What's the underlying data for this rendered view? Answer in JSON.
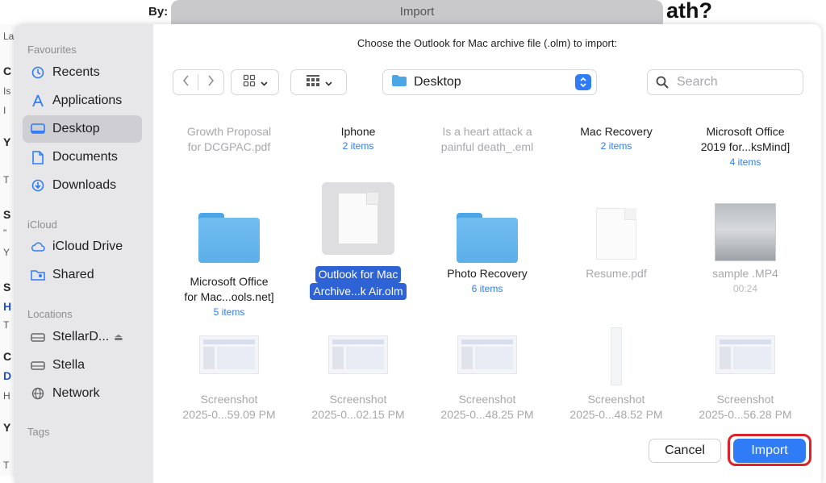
{
  "background": {
    "by_label": "By:",
    "title_fragment": "ath?",
    "left_letters": [
      "La",
      "C",
      "Is",
      "I",
      "Y",
      "T",
      "S",
      "\"",
      "Y",
      "S",
      "H",
      "T",
      "C",
      "D",
      "H",
      "Y",
      "T"
    ]
  },
  "titlebar": {
    "title": "Import"
  },
  "sidebar": {
    "favourites_label": "Favourites",
    "favourites": [
      {
        "label": "Recents",
        "icon": "clock-icon"
      },
      {
        "label": "Applications",
        "icon": "applications-icon"
      },
      {
        "label": "Desktop",
        "icon": "desktop-icon",
        "selected": true
      },
      {
        "label": "Documents",
        "icon": "document-icon"
      },
      {
        "label": "Downloads",
        "icon": "download-icon"
      }
    ],
    "icloud_label": "iCloud",
    "icloud": [
      {
        "label": "iCloud Drive",
        "icon": "cloud-icon"
      },
      {
        "label": "Shared",
        "icon": "shared-folder-icon"
      }
    ],
    "locations_label": "Locations",
    "locations": [
      {
        "label": "StellarD...",
        "icon": "drive-icon",
        "eject": "⏏"
      },
      {
        "label": "Stella",
        "icon": "drive-icon"
      },
      {
        "label": "Network",
        "icon": "globe-icon"
      }
    ],
    "tags_label": "Tags"
  },
  "main": {
    "prompt": "Choose the Outlook for Mac archive file (.olm) to import:",
    "location": "Desktop",
    "search_placeholder": "Search"
  },
  "files_row1": [
    {
      "name1": "Growth Proposal",
      "name2": "for DCGPAC.pdf",
      "sub": "",
      "dim": true
    },
    {
      "name1": "Iphone",
      "name2": "",
      "sub": "2 items",
      "dim": false
    },
    {
      "name1": "Is a heart attack a",
      "name2": "painful death_.eml",
      "sub": "",
      "dim": true
    },
    {
      "name1": "Mac Recovery",
      "name2": "",
      "sub": "2 items",
      "dim": false
    },
    {
      "name1": "Microsoft Office",
      "name2": "2019 for...ksMind]",
      "sub": "4 items",
      "dim": false
    }
  ],
  "files_row2": [
    {
      "name1": "Microsoft Office",
      "name2": "for Mac...ools.net]",
      "sub": "5 items",
      "kind": "folder"
    },
    {
      "name1": "Outlook for Mac",
      "name2": "Archive...k Air.olm",
      "sub": "",
      "kind": "selected-doc"
    },
    {
      "name1": "Photo Recovery",
      "name2": "",
      "sub": "6 items",
      "kind": "folder"
    },
    {
      "name1": "Resume.pdf",
      "name2": "",
      "sub": "",
      "kind": "pdf"
    },
    {
      "name1": "sample .MP4",
      "name2": "",
      "sub": "00:24",
      "kind": "video"
    }
  ],
  "files_row3": [
    {
      "name1": "Screenshot",
      "name2": "2025-0...59.09 PM"
    },
    {
      "name1": "Screenshot",
      "name2": "2025-0...02.15 PM"
    },
    {
      "name1": "Screenshot",
      "name2": "2025-0...48.25 PM"
    },
    {
      "name1": "Screenshot",
      "name2": "2025-0...48.52 PM"
    },
    {
      "name1": "Screenshot",
      "name2": "2025-0...56.28 PM"
    }
  ],
  "buttons": {
    "cancel": "Cancel",
    "import": "Import"
  },
  "colors": {
    "accent": "#2f7cf6",
    "highlight_ring": "#e0202a",
    "selection": "#2d63d4"
  }
}
